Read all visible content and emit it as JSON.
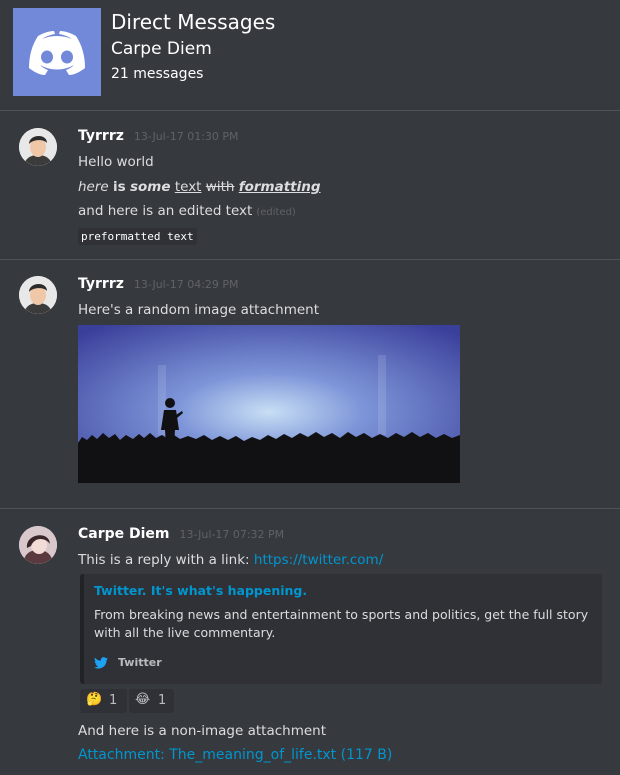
{
  "header": {
    "title": "Direct Messages",
    "channel": "Carpe Diem",
    "message_count": "21 messages",
    "icon": "discord-logo-icon",
    "icon_color": "#7289da"
  },
  "messages": [
    {
      "author": "Tyrrrz",
      "timestamp": "13-Jul-17 01:30 PM",
      "lines": {
        "l1": "Hello world",
        "f_italic": "here",
        "f_bold": "is",
        "f_bold_italic": "some",
        "f_underline": "text",
        "f_strike": "with",
        "f_all": "formatting",
        "l3": "and here is an edited text",
        "edited": "(edited)",
        "pre": "preformatted text"
      }
    },
    {
      "author": "Tyrrrz",
      "timestamp": "13-Jul-17 04:29 PM",
      "text": "Here's a random image attachment"
    },
    {
      "author": "Carpe Diem",
      "timestamp": "13-Jul-17 07:32 PM",
      "text": "This is a reply with a link:",
      "link": "https://twitter.com/",
      "embed": {
        "title": "Twitter. It's what's happening.",
        "description": "From breaking news and entertainment to sports and politics, get the full story with all the live commentary.",
        "provider": "Twitter",
        "provider_icon": "twitter-bird-icon"
      },
      "reactions": [
        {
          "emoji": "🤔",
          "count": "1",
          "name": "thinking"
        },
        {
          "emoji": "😂",
          "count": "1",
          "name": "joy"
        }
      ],
      "text2": "And here is a non-image attachment",
      "attachment": "Attachment: The_meaning_of_life.txt (117 B)"
    }
  ],
  "colors": {
    "background": "#36393e",
    "link": "#0096cf",
    "embed_bg": "#2f3136",
    "timestamp": "#5f6267"
  }
}
